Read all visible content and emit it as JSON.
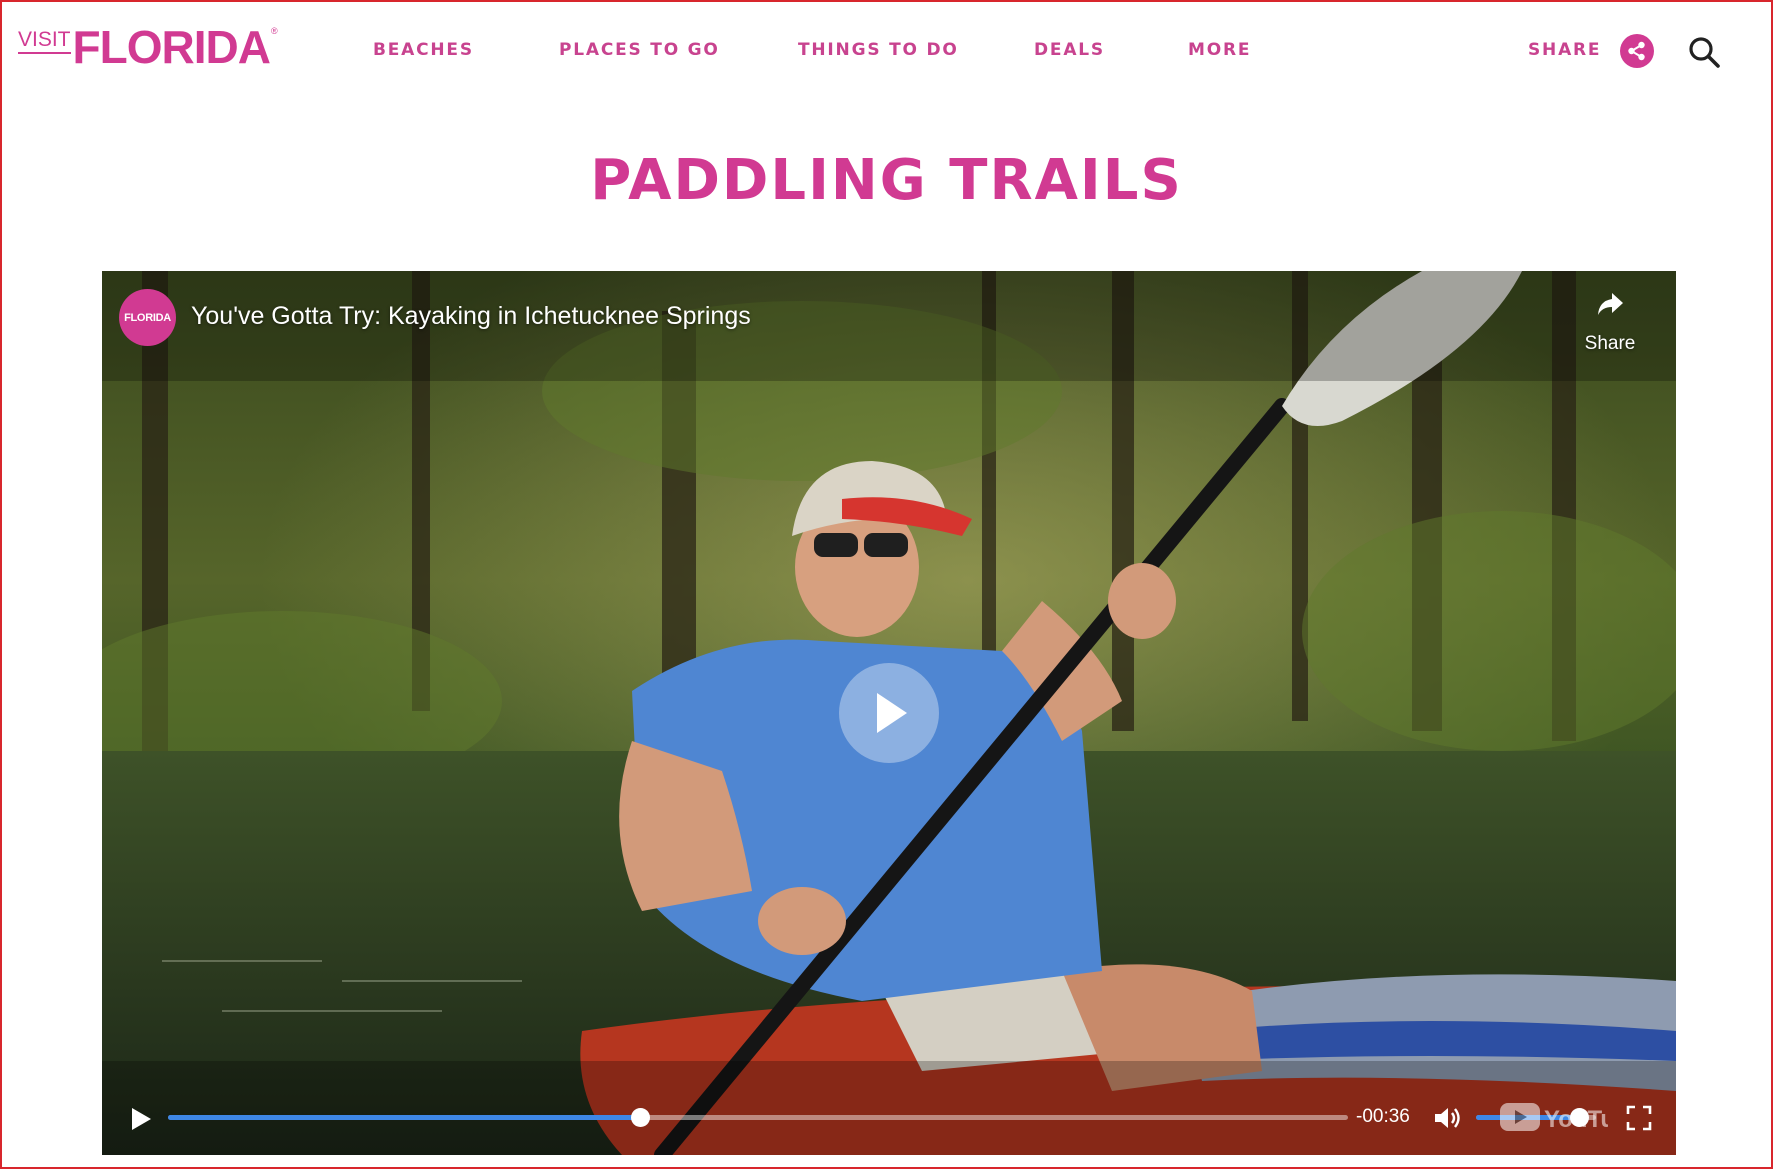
{
  "header": {
    "logo": {
      "visit": "VISIT",
      "florida": "FLORIDA",
      "reg": "®"
    },
    "nav": [
      {
        "label": "BEACHES"
      },
      {
        "label": "PLACES TO GO"
      },
      {
        "label": "THINGS TO DO"
      },
      {
        "label": "DEALS"
      },
      {
        "label": "MORE"
      }
    ],
    "share_label": "SHARE",
    "icons": {
      "share": "share-icon",
      "search": "search-icon"
    }
  },
  "page": {
    "title": "PADDLING TRAILS"
  },
  "video": {
    "channel": "FLORIDA",
    "title": "You've Gotta Try: Kayaking in Ichetucknee Springs",
    "share_label": "Share",
    "time_remaining": "-00:36",
    "progress_fraction": 0.4,
    "volume_fraction": 0.86,
    "brand": "YouTube"
  },
  "colors": {
    "brand_pink": "#d13a92",
    "progress_blue": "#3e87e6",
    "frame_red": "#d8262d"
  }
}
